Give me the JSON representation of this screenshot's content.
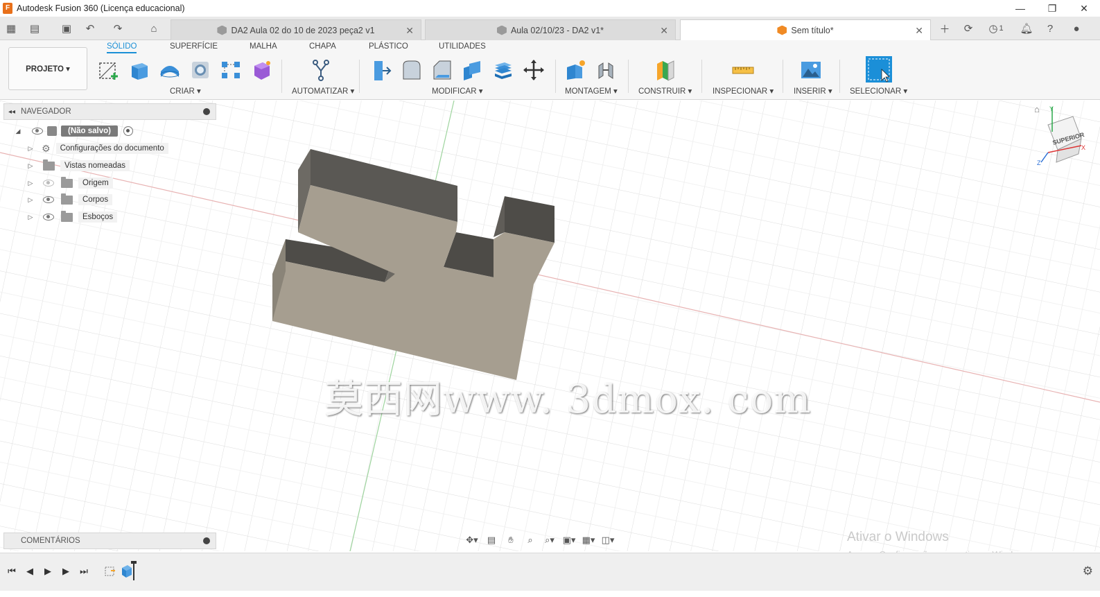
{
  "window": {
    "title": "Autodesk Fusion 360 (Licença educacional)",
    "logo_text": "F"
  },
  "tabs": [
    {
      "label": "DA2 Aula 02 do 10 de 2023 peça2 v1",
      "active": false
    },
    {
      "label": "Aula 02/10/23 - DA2 v1*",
      "active": false
    },
    {
      "label": "Sem título*",
      "active": true
    }
  ],
  "tab_close": "✕",
  "header_right": {
    "job_count": "1"
  },
  "ribbon": {
    "project_label": "PROJETO ▾",
    "tabs": [
      "SÓLIDO",
      "SUPERFÍCIE",
      "MALHA",
      "CHAPA",
      "PLÁSTICO",
      "UTILIDADES"
    ],
    "groups": [
      "CRIAR ▾",
      "AUTOMATIZAR ▾",
      "MODIFICAR ▾",
      "MONTAGEM ▾",
      "CONSTRUIR ▾",
      "INSPECIONAR ▾",
      "INSERIR ▾",
      "SELECIONAR ▾"
    ]
  },
  "navigator": {
    "title": "NAVEGADOR",
    "root": "(Não salvo)",
    "items": [
      {
        "label": "Configurações do documento",
        "icon": "gear-icon"
      },
      {
        "label": "Vistas nomeadas",
        "icon": "folder-icon"
      },
      {
        "label": "Origem",
        "icon": "folder-icon",
        "visible": false
      },
      {
        "label": "Corpos",
        "icon": "folder-icon",
        "visible": true
      },
      {
        "label": "Esboços",
        "icon": "folder-icon",
        "visible": true
      }
    ]
  },
  "comments": {
    "title": "COMENTÁRIOS"
  },
  "viewcube": {
    "face_label": "SUPERIOR",
    "axis_x": "X",
    "axis_y": "Y",
    "axis_z": "Z"
  },
  "overlay_watermark": "莫西网www. 3dmox. com",
  "windows_activation": {
    "title": "Ativar o Windows",
    "subtitle": "Acesse Configurações para ativar o Windows."
  }
}
